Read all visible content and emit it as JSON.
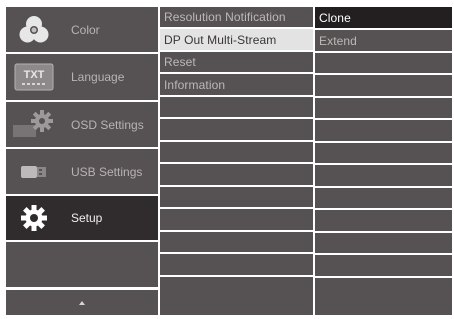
{
  "main_menu": {
    "items": [
      {
        "label": "Color",
        "icon": "color-icon"
      },
      {
        "label": "Language",
        "icon": "language-icon",
        "icon_text": "TXT"
      },
      {
        "label": "OSD Settings",
        "icon": "osd-settings-icon"
      },
      {
        "label": "USB Settings",
        "icon": "usb-settings-icon"
      },
      {
        "label": "Setup",
        "icon": "setup-icon"
      }
    ],
    "active_index": 4,
    "scroll_icon": "up-arrow-icon"
  },
  "setup_submenu": {
    "items": [
      {
        "label": "Resolution Notification"
      },
      {
        "label": "DP Out Multi-Stream"
      },
      {
        "label": "Reset"
      },
      {
        "label": "Information"
      }
    ],
    "selected_index": 1
  },
  "options_menu": {
    "items": [
      {
        "label": "Clone"
      },
      {
        "label": "Extend"
      }
    ],
    "active_index": 0
  },
  "colors": {
    "panel_gray": "#565152",
    "active_main": "#302b2c",
    "selected_sub": "#e3e3e3",
    "active_option": "#231f20"
  }
}
